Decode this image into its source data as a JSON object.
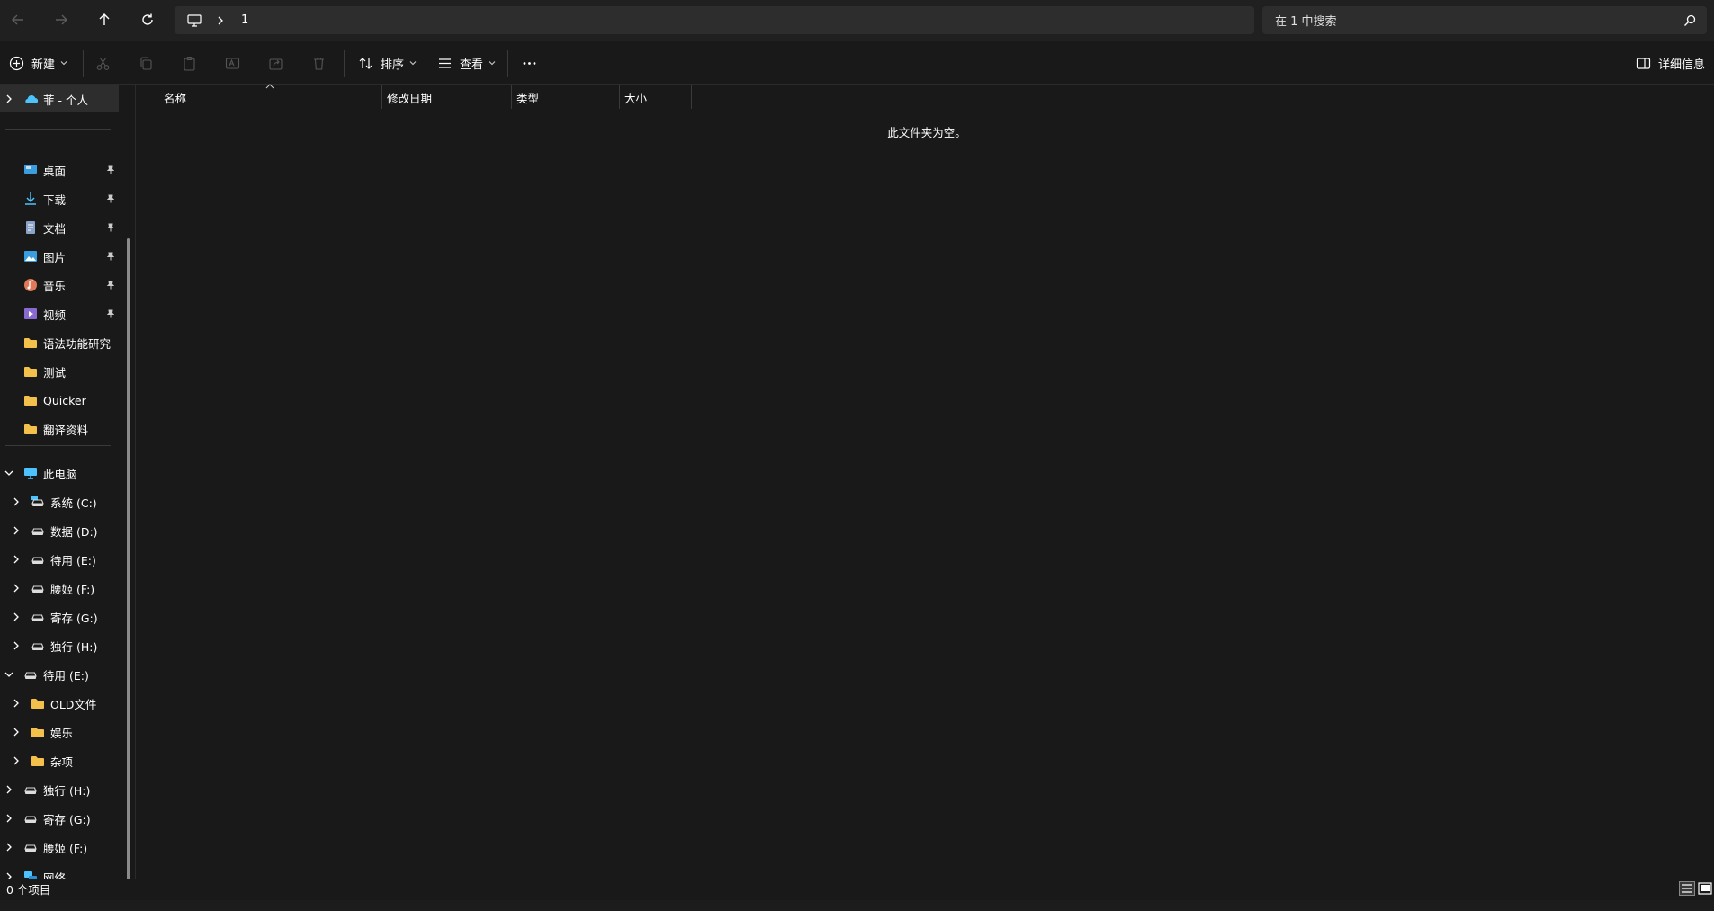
{
  "address": {
    "crumb": "1"
  },
  "search": {
    "placeholder": "在 1 中搜索"
  },
  "toolbar": {
    "new_label": "新建",
    "sort_label": "排序",
    "view_label": "查看",
    "details_label": "详细信息"
  },
  "sidebar": {
    "onedrive": "菲 - 个人",
    "quick": [
      {
        "label": "桌面",
        "icon": "desktop-icon",
        "pinned": true
      },
      {
        "label": "下载",
        "icon": "download-icon",
        "pinned": true
      },
      {
        "label": "文档",
        "icon": "document-icon",
        "pinned": true
      },
      {
        "label": "图片",
        "icon": "picture-icon",
        "pinned": true
      },
      {
        "label": "音乐",
        "icon": "music-icon",
        "pinned": true
      },
      {
        "label": "视频",
        "icon": "video-icon",
        "pinned": true
      },
      {
        "label": "语法功能研究",
        "icon": "folder-icon",
        "pinned": false
      },
      {
        "label": "测试",
        "icon": "folder-icon",
        "pinned": false
      },
      {
        "label": "Quicker",
        "icon": "folder-icon",
        "pinned": false
      },
      {
        "label": "翻译资料",
        "icon": "folder-icon",
        "pinned": false
      }
    ],
    "this_pc": "此电脑",
    "drives": [
      {
        "label": "系统 (C:)",
        "icon": "system-drive-icon"
      },
      {
        "label": "数据 (D:)",
        "icon": "drive-icon"
      },
      {
        "label": "待用 (E:)",
        "icon": "drive-icon"
      },
      {
        "label": "腰姬 (F:)",
        "icon": "drive-icon"
      },
      {
        "label": "寄存 (G:)",
        "icon": "drive-icon"
      },
      {
        "label": "独行 (H:)",
        "icon": "drive-icon"
      }
    ],
    "expanded_drive": "待用 (E:)",
    "expanded_children": [
      {
        "label": "OLD文件",
        "icon": "folder-icon"
      },
      {
        "label": "娱乐",
        "icon": "folder-icon"
      },
      {
        "label": "杂项",
        "icon": "folder-icon"
      }
    ],
    "bottom_drives": [
      {
        "label": "独行 (H:)",
        "icon": "drive-icon"
      },
      {
        "label": "寄存 (G:)",
        "icon": "drive-icon"
      },
      {
        "label": "腰姬 (F:)",
        "icon": "drive-icon"
      }
    ],
    "network": "网络"
  },
  "columns": {
    "name": "名称",
    "modified": "修改日期",
    "type": "类型",
    "size": "大小"
  },
  "content": {
    "empty_message": "此文件夹为空。"
  },
  "status": {
    "item_count": "0 个项目"
  },
  "colors": {
    "background": "#191919",
    "bar": "#202020",
    "field": "#2d2d2d",
    "folder": "#f4c04c",
    "accent": "#4cc2ff"
  }
}
